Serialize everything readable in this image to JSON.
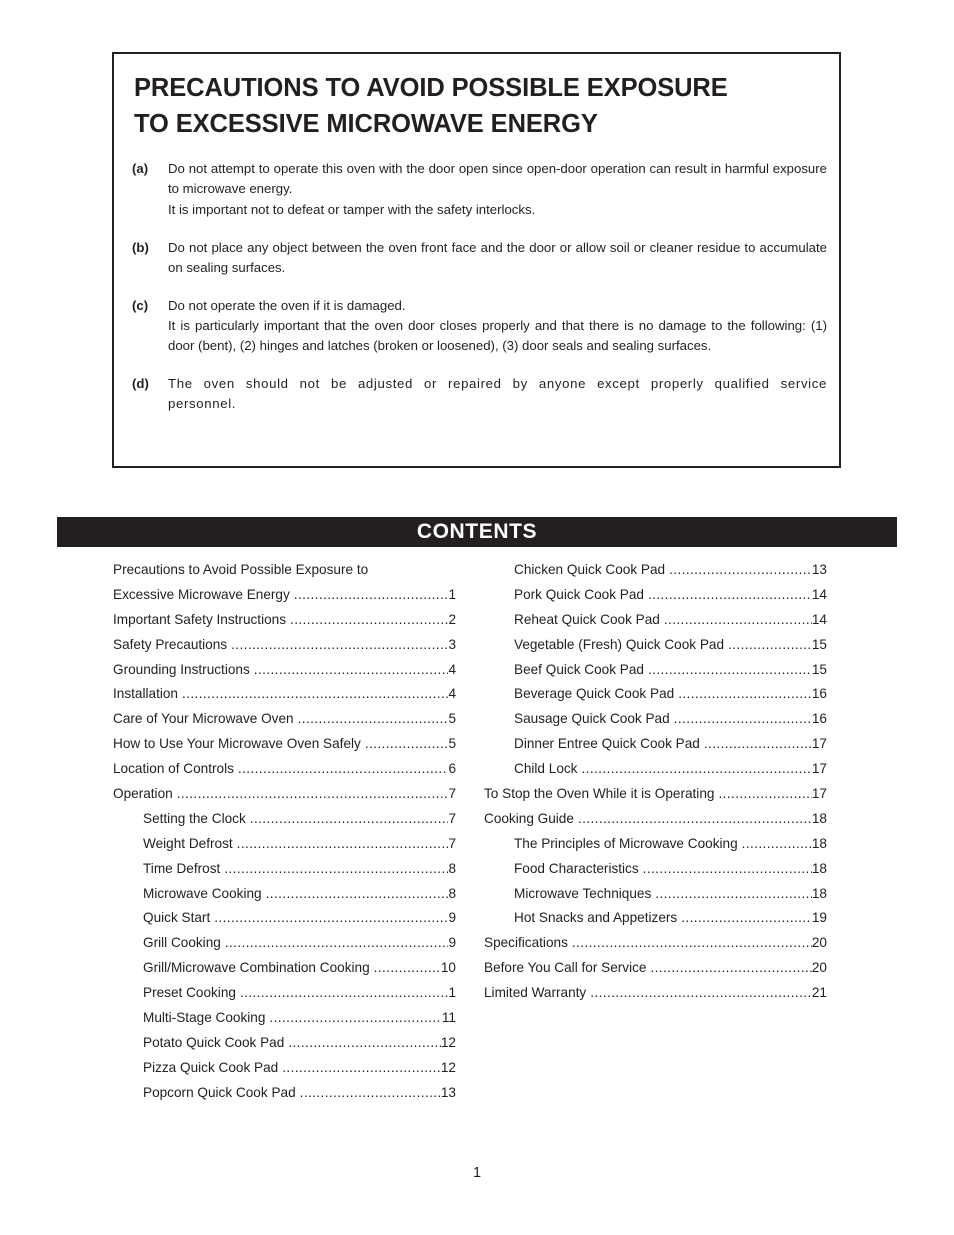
{
  "warning": {
    "title_lines": [
      "PRECAUTIONS TO AVOID POSSIBLE EXPOSURE",
      "TO EXCESSIVE MICROWAVE ENERGY"
    ],
    "items": [
      {
        "label": "(a)",
        "paragraphs": [
          "Do not attempt to operate this oven with the door open since open-door operation can result in harmful exposure to microwave energy.",
          "It is important not to defeat or tamper with the safety interlocks."
        ]
      },
      {
        "label": "(b)",
        "paragraphs": [
          "Do not place any object between the oven front face and the door or allow soil or cleaner residue to accumulate on sealing surfaces."
        ]
      },
      {
        "label": "(c)",
        "paragraphs": [
          "Do not operate the oven if it is damaged.",
          "It is particularly important that the oven door closes properly and that there is no damage to the following: (1) door (bent), (2) hinges and latches (broken or loosened), (3) door seals and sealing surfaces."
        ]
      },
      {
        "label": "(d)",
        "paragraphs": [
          "The oven should not be adjusted or repaired by anyone except properly qualified service personnel."
        ]
      }
    ]
  },
  "contents": {
    "heading": "CONTENTS",
    "left_column": [
      {
        "title": "Precautions to Avoid Possible Exposure to",
        "page": "",
        "indent": false,
        "dots": false
      },
      {
        "title": "Excessive Microwave Energy",
        "page": "1",
        "indent": false,
        "dots": true
      },
      {
        "title": "Important Safety Instructions",
        "page": "2",
        "indent": false,
        "dots": true
      },
      {
        "title": "Safety Precautions",
        "page": "3",
        "indent": false,
        "dots": true
      },
      {
        "title": "Grounding Instructions",
        "page": "4",
        "indent": false,
        "dots": true
      },
      {
        "title": "Installation",
        "page": "4",
        "indent": false,
        "dots": true
      },
      {
        "title": "Care of Your Microwave Oven",
        "page": "5",
        "indent": false,
        "dots": true
      },
      {
        "title": "How to Use Your Microwave Oven Safely",
        "page": "5",
        "indent": false,
        "dots": true
      },
      {
        "title": "Location of Controls",
        "page": "6",
        "indent": false,
        "dots": true
      },
      {
        "title": "Operation",
        "page": "7",
        "indent": false,
        "dots": true
      },
      {
        "title": "Setting the Clock",
        "page": "7",
        "indent": true,
        "dots": true
      },
      {
        "title": "Weight Defrost",
        "page": "7",
        "indent": true,
        "dots": true
      },
      {
        "title": "Time Defrost",
        "page": "8",
        "indent": true,
        "dots": true
      },
      {
        "title": "Microwave Cooking",
        "page": "8",
        "indent": true,
        "dots": true
      },
      {
        "title": "Quick Start",
        "page": "9",
        "indent": true,
        "dots": true
      },
      {
        "title": "Grill Cooking",
        "page": "9",
        "indent": true,
        "dots": true
      },
      {
        "title": "Grill/Microwave Combination Cooking",
        "page": "10",
        "indent": true,
        "dots": true
      },
      {
        "title": "Preset Cooking",
        "page": "1",
        "indent": true,
        "dots": true
      },
      {
        "title": "Multi-Stage Cooking",
        "page": "11",
        "indent": true,
        "dots": true
      },
      {
        "title": "Potato Quick Cook Pad",
        "page": "12",
        "indent": true,
        "dots": true
      },
      {
        "title": "Pizza Quick Cook Pad",
        "page": "12",
        "indent": true,
        "dots": true
      },
      {
        "title": "Popcorn Quick Cook Pad",
        "page": "13",
        "indent": true,
        "dots": true
      }
    ],
    "right_column": [
      {
        "title": "Chicken Quick Cook Pad",
        "page": "13",
        "indent": true,
        "dots": true
      },
      {
        "title": "Pork Quick Cook Pad",
        "page": "14",
        "indent": true,
        "dots": true
      },
      {
        "title": "Reheat Quick Cook Pad",
        "page": "14",
        "indent": true,
        "dots": true
      },
      {
        "title": "Vegetable (Fresh) Quick Cook Pad",
        "page": "15",
        "indent": true,
        "dots": true
      },
      {
        "title": "Beef Quick Cook Pad",
        "page": "15",
        "indent": true,
        "dots": true
      },
      {
        "title": "Beverage Quick Cook Pad",
        "page": "16",
        "indent": true,
        "dots": true
      },
      {
        "title": "Sausage Quick Cook Pad",
        "page": "16",
        "indent": true,
        "dots": true
      },
      {
        "title": "Dinner Entree Quick Cook Pad",
        "page": "17",
        "indent": true,
        "dots": true
      },
      {
        "title": "Child Lock",
        "page": "17",
        "indent": true,
        "dots": true
      },
      {
        "title": "To Stop the Oven While it is Operating",
        "page": "17",
        "indent": false,
        "dots": true
      },
      {
        "title": "Cooking Guide",
        "page": "18",
        "indent": false,
        "dots": true
      },
      {
        "title": "The Principles of Microwave Cooking",
        "page": "18",
        "indent": true,
        "dots": true
      },
      {
        "title": "Food Characteristics",
        "page": "18",
        "indent": true,
        "dots": true
      },
      {
        "title": "Microwave Techniques",
        "page": "18",
        "indent": true,
        "dots": true
      },
      {
        "title": "Hot Snacks and Appetizers",
        "page": "19",
        "indent": true,
        "dots": true
      },
      {
        "title": "Specifications",
        "page": "20",
        "indent": false,
        "dots": true
      },
      {
        "title": "Before You Call for Service",
        "page": "20",
        "indent": false,
        "dots": true
      },
      {
        "title": "Limited Warranty",
        "page": "21",
        "indent": false,
        "dots": true
      }
    ]
  },
  "footer": {
    "page_number": "1"
  }
}
